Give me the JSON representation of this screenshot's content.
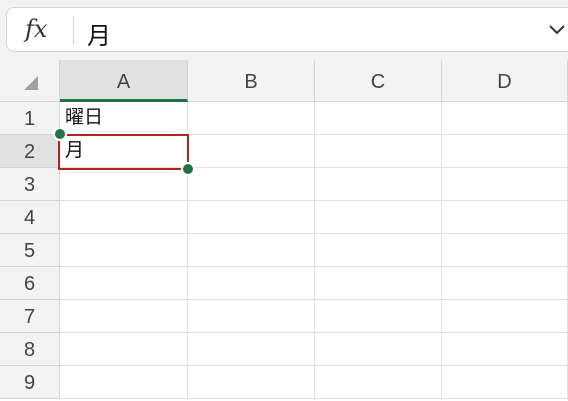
{
  "formula_bar": {
    "fx_label": "fx",
    "value": "月"
  },
  "columns": [
    "A",
    "B",
    "C",
    "D"
  ],
  "rows": [
    "1",
    "2",
    "3",
    "4",
    "5",
    "6",
    "7",
    "8",
    "9"
  ],
  "cells": {
    "A1": "曜日",
    "A2": "月"
  },
  "selection": {
    "active_cell": "A2",
    "column": "A",
    "row": "2"
  },
  "colors": {
    "selection_border": "#b2231a",
    "handle": "#217346",
    "active_header_underline": "#1e7145"
  }
}
